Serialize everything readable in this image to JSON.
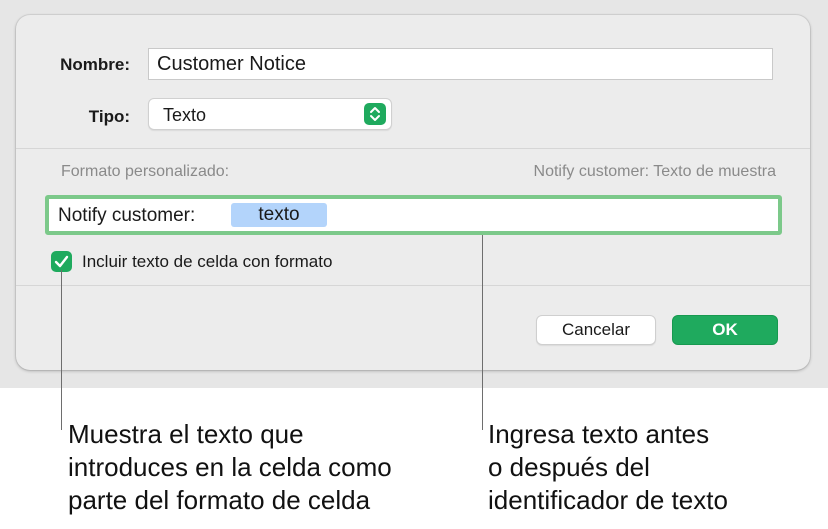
{
  "dialog": {
    "name_label": "Nombre:",
    "name_value": "Customer Notice",
    "type_label": "Tipo:",
    "type_value": "Texto",
    "custom_format_label": "Formato personalizado:",
    "preview_text": "Notify customer: Texto de muestra",
    "format_prefix": "Notify customer:",
    "format_token": "texto",
    "include_checkbox_label": "Incluir texto de celda con formato",
    "include_checkbox_checked": true,
    "cancel_label": "Cancelar",
    "ok_label": "OK"
  },
  "callouts": {
    "left": [
      "Muestra el texto que",
      "introduces en la celda como",
      "parte del formato de celda"
    ],
    "right": [
      "Ingresa texto antes",
      "o después del",
      "identificador de texto"
    ]
  },
  "icons": {
    "popup_arrows": "chevron-updown-icon",
    "checkbox_check": "checkmark-icon"
  },
  "colors": {
    "accent": "#1faa5e",
    "focus_ring": "#7cc98a",
    "token_highlight": "#b3d4fb"
  }
}
